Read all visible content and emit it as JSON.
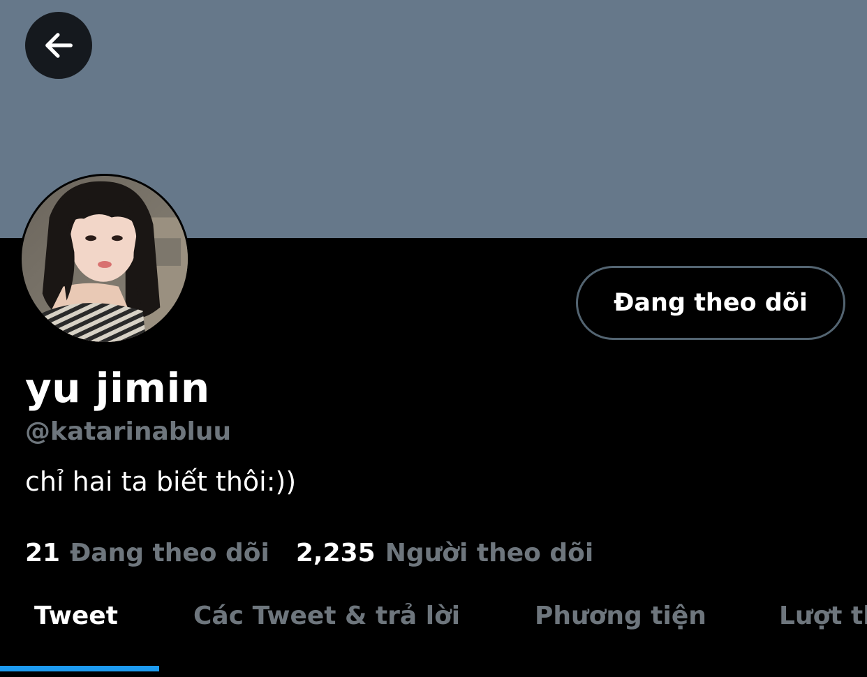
{
  "header": {
    "back_icon": "arrow-left-icon",
    "banner_color": "#66788a"
  },
  "profile": {
    "avatar": "profile-photo",
    "follow_button_label": "Đang theo dõi",
    "display_name": "yu jimin",
    "handle": "@katarinabluu",
    "bio": "chỉ hai ta biết thôi:))"
  },
  "stats": {
    "following_count": "21",
    "following_label": "Đang theo dõi",
    "followers_count": "2,235",
    "followers_label": "Người theo dõi"
  },
  "tabs": [
    {
      "label": "Tweet",
      "active": true
    },
    {
      "label": "Các Tweet & trả lời",
      "active": false
    },
    {
      "label": "Phương tiện",
      "active": false
    },
    {
      "label": "Lượt thích",
      "active": false
    }
  ],
  "colors": {
    "background": "#000000",
    "secondary_text": "#6e767d",
    "accent": "#1d9bf0"
  }
}
